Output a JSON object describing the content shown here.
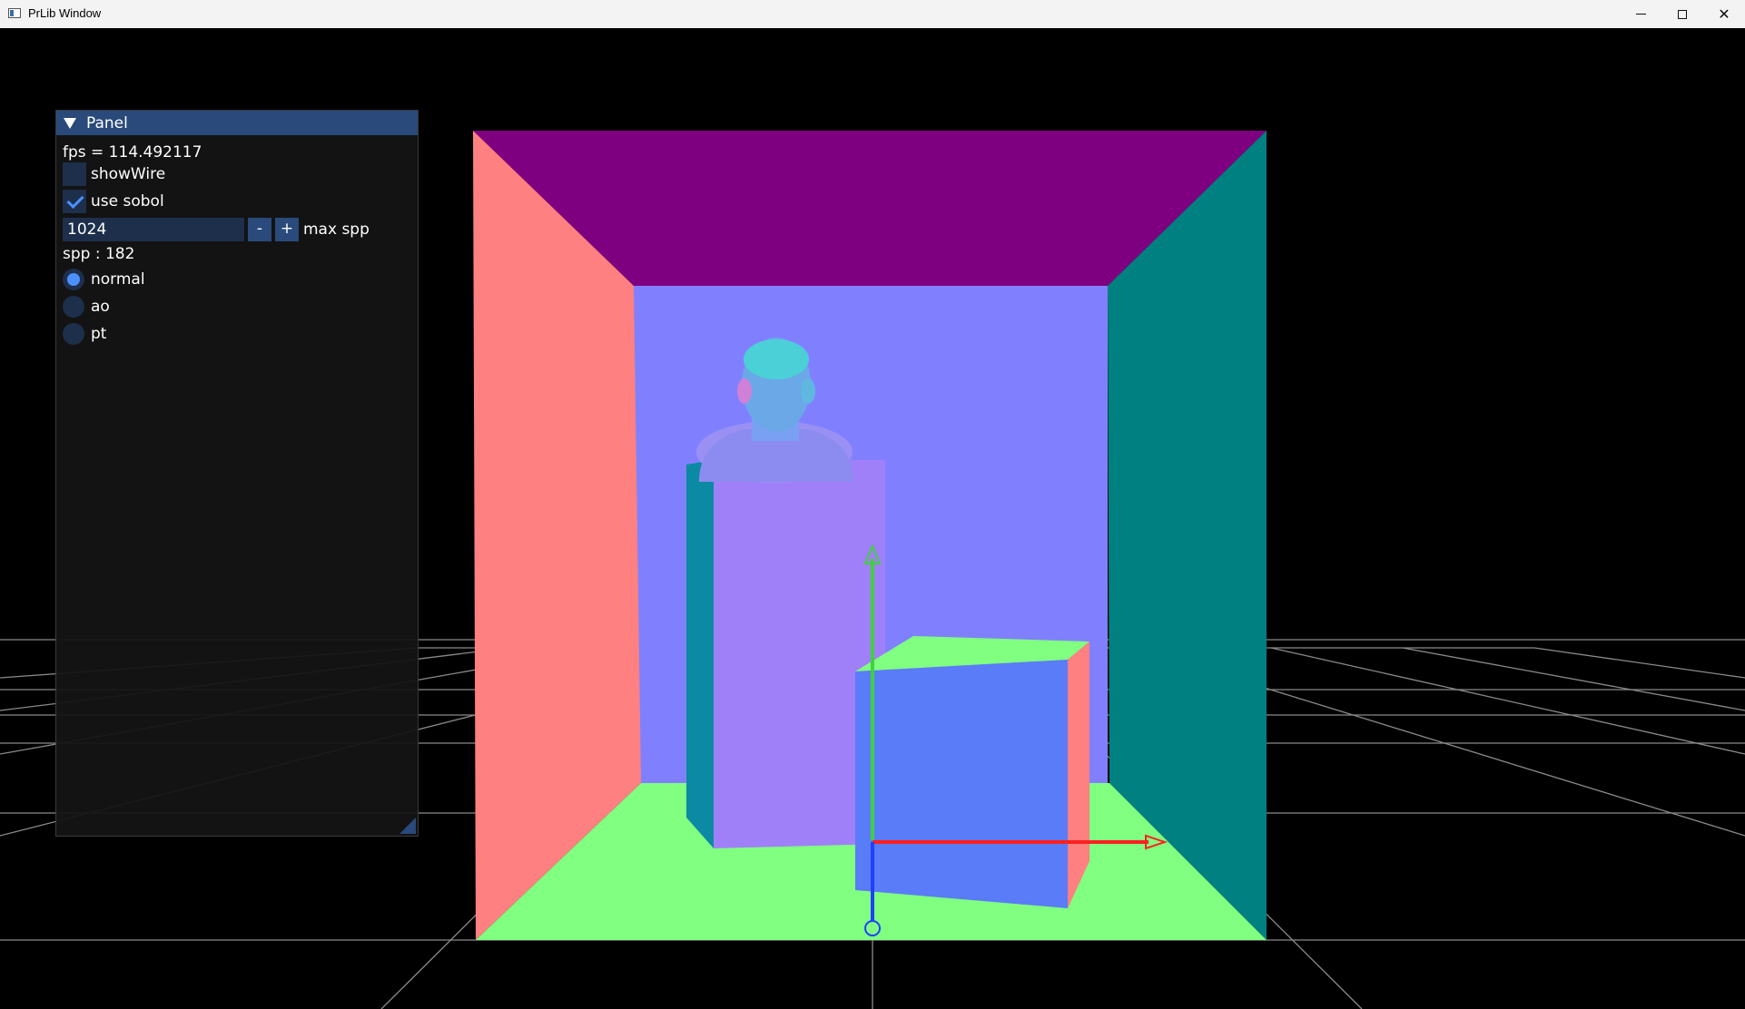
{
  "window": {
    "title": "PrLib Window",
    "controls": {
      "minimize": "minimize",
      "maximize": "maximize",
      "close": "close"
    }
  },
  "panel": {
    "title": "Panel",
    "fps_text": "fps = 114.492117",
    "show_wire": {
      "label": "showWire",
      "checked": false
    },
    "use_sobol": {
      "label": "use sobol",
      "checked": true
    },
    "max_spp": {
      "value": "1024",
      "minus": "-",
      "plus": "+",
      "label": "max spp"
    },
    "spp_text": "spp : 182",
    "render_modes": [
      {
        "label": "normal",
        "selected": true
      },
      {
        "label": "ao",
        "selected": false
      },
      {
        "label": "pt",
        "selected": false
      }
    ]
  },
  "scene": {
    "colors": {
      "background": "#000000",
      "grid": "#8a8a8a",
      "ceiling": "#7e0080",
      "back_wall": "#8080ff",
      "left_wall": "#ff8080",
      "right_wall": "#008080",
      "floor": "#80ff80",
      "axis_x": "#ff2020",
      "axis_y": "#40d040",
      "axis_z": "#2040ff"
    }
  }
}
